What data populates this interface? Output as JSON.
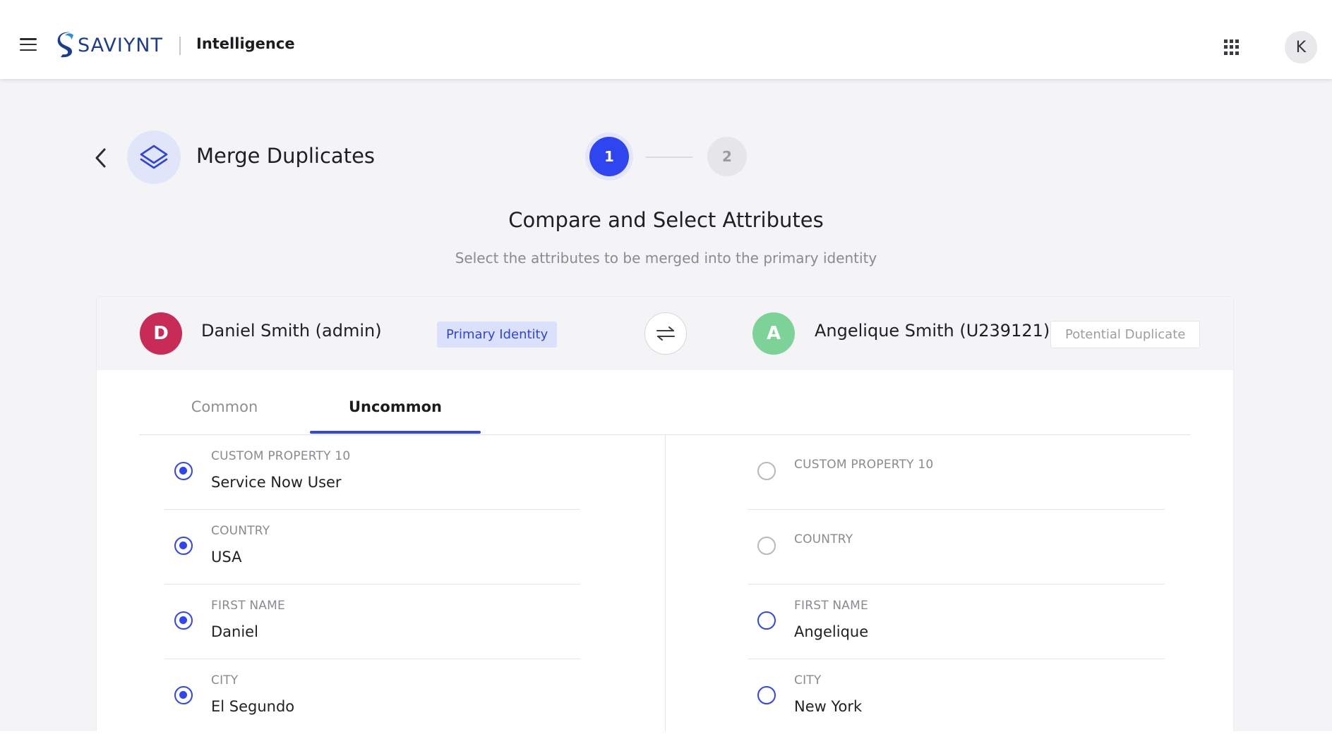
{
  "header": {
    "logo_text": "SAVIYNT",
    "product_name": "Intelligence",
    "user_initial": "K"
  },
  "page": {
    "title": "Merge Duplicates",
    "steps": [
      "1",
      "2"
    ],
    "current_step": 1,
    "section_title": "Compare and Select Attributes",
    "section_subtitle": "Select the attributes to be merged into the primary identity"
  },
  "identities": {
    "primary": {
      "initial": "D",
      "name": "Daniel Smith (admin)",
      "badge": "Primary Identity",
      "color": "#c82b55"
    },
    "duplicate": {
      "initial": "A",
      "name": "Angelique Smith (U239121)",
      "badge": "Potential Duplicate",
      "color": "#7dd397"
    }
  },
  "tabs": [
    {
      "label": "Common",
      "active": false
    },
    {
      "label": "Uncommon",
      "active": true
    }
  ],
  "attributes": {
    "left": [
      {
        "label": "CUSTOM PROPERTY 10",
        "value": "Service Now User",
        "state": "selected"
      },
      {
        "label": "COUNTRY",
        "value": "USA",
        "state": "selected"
      },
      {
        "label": "FIRST NAME",
        "value": "Daniel",
        "state": "selected"
      },
      {
        "label": "CITY",
        "value": "El Segundo",
        "state": "selected"
      }
    ],
    "right": [
      {
        "label": "CUSTOM PROPERTY 10",
        "value": "",
        "state": "disabled"
      },
      {
        "label": "COUNTRY",
        "value": "",
        "state": "disabled"
      },
      {
        "label": "FIRST NAME",
        "value": "Angelique",
        "state": "available"
      },
      {
        "label": "CITY",
        "value": "New York",
        "state": "available"
      }
    ]
  },
  "colors": {
    "accent": "#2f45f0",
    "primary_badge_bg": "#dbe0fc"
  },
  "icons": {
    "menu": "hamburger-menu-icon",
    "back": "chevron-left-icon",
    "title": "layers-icon",
    "swap": "swap-arrows-icon",
    "apps": "apps-grid-icon"
  }
}
